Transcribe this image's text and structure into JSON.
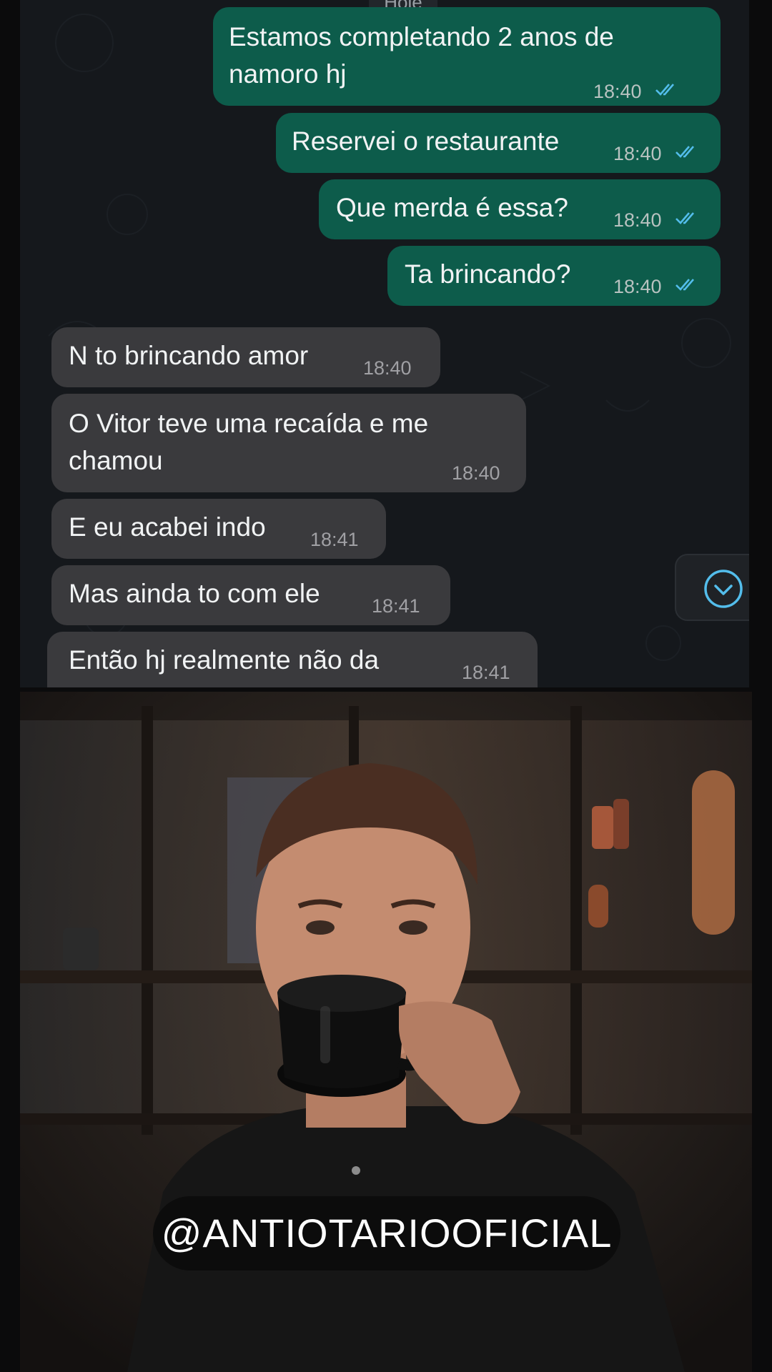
{
  "chat": {
    "date_label": "Hoje",
    "messages": [
      {
        "direction": "out",
        "text": "Estamos completando 2 anos de\nnamoro hj",
        "time": "18:40",
        "read": true
      },
      {
        "direction": "out",
        "text": "Reservei o restaurante",
        "time": "18:40",
        "read": true
      },
      {
        "direction": "out",
        "text": "Que merda é essa?",
        "time": "18:40",
        "read": true
      },
      {
        "direction": "out",
        "text": "Ta brincando?",
        "time": "18:40",
        "read": true
      },
      {
        "direction": "in",
        "text": "N to brincando amor",
        "time": "18:40"
      },
      {
        "direction": "in",
        "text": "O Vitor teve uma recaída e me\nchamou",
        "time": "18:40"
      },
      {
        "direction": "in",
        "text": "E eu acabei indo",
        "time": "18:41"
      },
      {
        "direction": "in",
        "text": "Mas ainda to com ele",
        "time": "18:41"
      },
      {
        "direction": "in",
        "text": "Então hj realmente não da",
        "time": "18:41"
      }
    ],
    "scroll_down_icon": "chevron-down-circle-icon"
  },
  "video": {
    "handle": "@ANTIOTARIOOFICIAL"
  },
  "colors": {
    "outgoing_bubble": "#0d5c4b",
    "incoming_bubble": "#3a3a3d",
    "read_ticks": "#53bdeb",
    "chat_background": "#15181c"
  }
}
